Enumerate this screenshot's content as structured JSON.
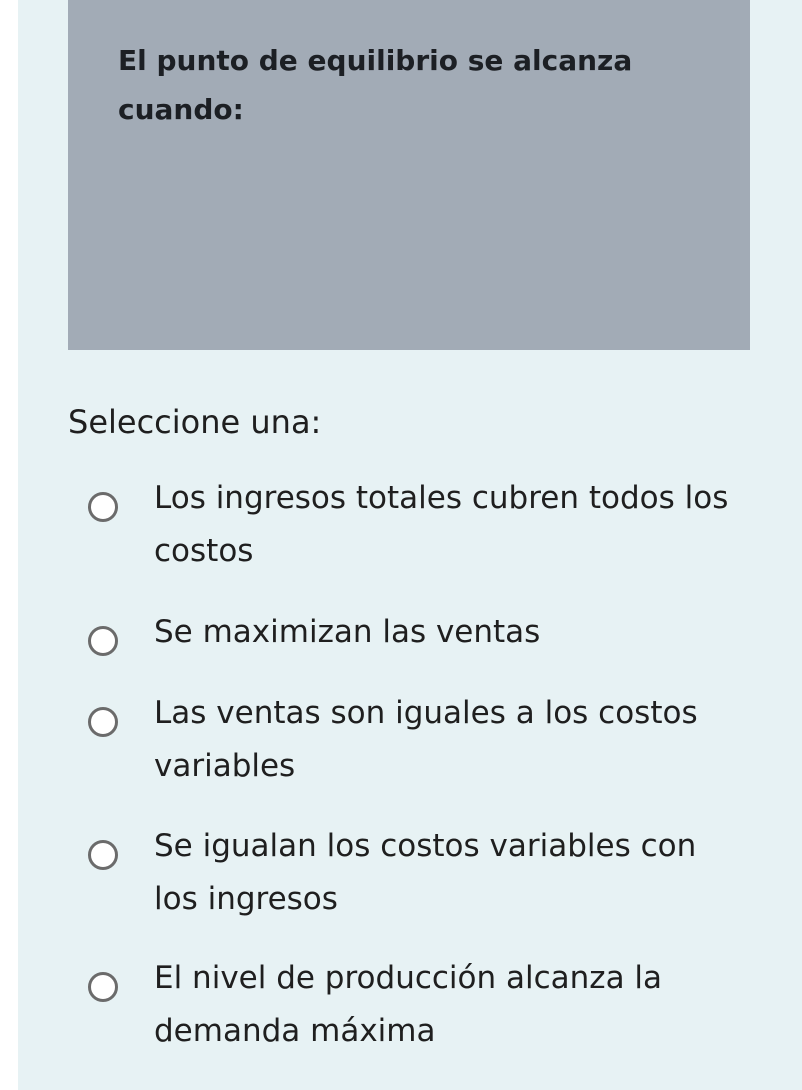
{
  "question": {
    "text": "El punto de equilibrio se alcanza cuando:"
  },
  "prompt": "Seleccione una:",
  "options": [
    {
      "label": "Los ingresos totales cubren todos los costos",
      "selected": false
    },
    {
      "label": "Se maximizan las ventas",
      "selected": false
    },
    {
      "label": "Las ventas son iguales a los costos variables",
      "selected": false
    },
    {
      "label": "Se igualan los costos variables con los ingresos",
      "selected": false
    },
    {
      "label": "El nivel de producción alcanza la demanda máxima",
      "selected": false
    }
  ],
  "colors": {
    "panel_bg": "#e7f2f4",
    "question_bg": "#a2abb6",
    "radio_border": "#6b6b6b"
  }
}
